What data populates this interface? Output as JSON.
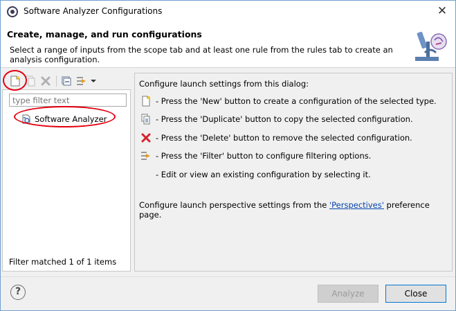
{
  "window": {
    "title": "Software Analyzer Configurations",
    "close_glyph": "✕"
  },
  "header": {
    "title": "Create, manage, and run configurations",
    "description": "Select a range of inputs from the scope tab and at least one rule from the rules tab to create an analysis configuration."
  },
  "toolbar": {
    "icons": [
      "new-configuration-icon",
      "duplicate-icon",
      "delete-icon",
      "collapse-all-icon",
      "filter-icon",
      "dropdown-arrow-icon"
    ]
  },
  "left_panel": {
    "filter_placeholder": "type filter text",
    "tree_items": [
      {
        "label": "Software Analyzer",
        "icon": "software-analyzer-icon"
      }
    ],
    "status": "Filter matched 1 of 1 items"
  },
  "right_panel": {
    "intro": "Configure launch settings from this dialog:",
    "rows": [
      {
        "icon": "new-icon",
        "text": "- Press the 'New' button to create a configuration of the selected type."
      },
      {
        "icon": "duplicate-icon",
        "text": "- Press the 'Duplicate' button to copy the selected configuration."
      },
      {
        "icon": "delete-icon",
        "text": "- Press the 'Delete' button to remove the selected configuration."
      },
      {
        "icon": "filter-icon",
        "text": "- Press the 'Filter' button to configure filtering options."
      },
      {
        "icon": "",
        "text": "- Edit or view an existing configuration by selecting it."
      }
    ],
    "perspective_prefix": "Configure launch perspective settings from the ",
    "perspective_link": "'Perspectives'",
    "perspective_suffix": " preference page."
  },
  "footer": {
    "help_glyph": "?",
    "analyze_label": "Analyze",
    "close_label": "Close"
  },
  "colors": {
    "annotation_red": "#e3000f",
    "link_blue": "#0645ad",
    "focus_blue": "#0078d7"
  }
}
